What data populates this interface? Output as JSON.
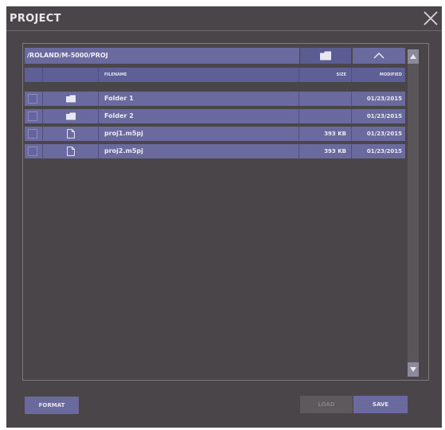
{
  "dialog": {
    "title": "PROJECT",
    "close_icon": "close-icon"
  },
  "browser": {
    "path": "/ROLAND/M-5000/PROJ",
    "new_folder_icon": "folder-icon",
    "up_icon": "chevron-up-icon",
    "columns": {
      "filename": "FILENAME",
      "size": "SIZE",
      "modified": "MODIFIED"
    },
    "rows": [
      {
        "type": "folder",
        "icon": "folder-icon",
        "name": "Folder 1",
        "size": "",
        "modified": "01/23/2015"
      },
      {
        "type": "folder",
        "icon": "folder-icon",
        "name": "Folder 2",
        "size": "",
        "modified": "01/23/2015"
      },
      {
        "type": "file",
        "icon": "file-icon",
        "name": "proj1.m5pj",
        "size": "393 KB",
        "modified": "01/23/2015"
      },
      {
        "type": "file",
        "icon": "file-icon",
        "name": "proj2.m5pj",
        "size": "393 KB",
        "modified": "01/23/2015"
      }
    ]
  },
  "footer": {
    "format_label": "FORMAT",
    "load_label": "LOAD",
    "save_label": "SAVE"
  },
  "colors": {
    "background": "#4a4548",
    "row": "#6a6a9e",
    "header": "#5e5f95"
  }
}
